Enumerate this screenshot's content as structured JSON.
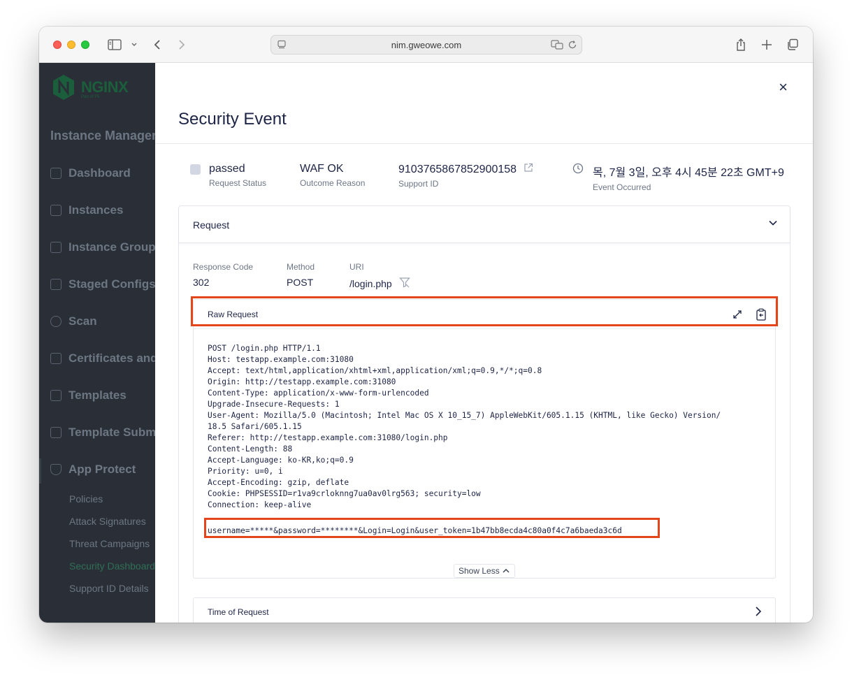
{
  "browser": {
    "url": "nim.gweowe.com"
  },
  "sidebar": {
    "logo_text": "NGINX",
    "logo_sub": "Part of F5",
    "section_title": "Instance Manager",
    "items": [
      {
        "label": "Dashboard",
        "icon": "bar-chart-icon"
      },
      {
        "label": "Instances",
        "icon": "server-icon"
      },
      {
        "label": "Instance Groups",
        "icon": "group-icon"
      },
      {
        "label": "Staged Configs",
        "icon": "staged-icon"
      },
      {
        "label": "Scan",
        "icon": "scan-icon"
      },
      {
        "label": "Certificates and Keys",
        "icon": "certificate-icon"
      },
      {
        "label": "Templates",
        "icon": "template-icon"
      },
      {
        "label": "Template Submissions",
        "icon": "archive-icon"
      }
    ],
    "app_protect": {
      "label": "App Protect",
      "icon": "shield-icon",
      "subitems": [
        {
          "label": "Policies"
        },
        {
          "label": "Attack Signatures"
        },
        {
          "label": "Threat Campaigns"
        },
        {
          "label": "Security Dashboard"
        },
        {
          "label": "Support ID Details"
        }
      ]
    }
  },
  "panel": {
    "title": "Security Event",
    "close_label": "×",
    "summary": {
      "status_value": "passed",
      "status_label": "Request Status",
      "reason_value": "WAF OK",
      "reason_label": "Outcome Reason",
      "support_value": "9103765867852900158",
      "support_label": "Support ID",
      "event_value": "목, 7월 3일, 오후 4시 45분 22초 GMT+9",
      "event_label": "Event Occurred"
    },
    "request": {
      "header": "Request",
      "response_code_label": "Response Code",
      "response_code": "302",
      "method_label": "Method",
      "method": "POST",
      "uri_label": "URI",
      "uri": "/login.php",
      "raw_request_label": "Raw Request",
      "raw_lines": [
        "POST /login.php HTTP/1.1",
        "Host: testapp.example.com:31080",
        "Accept: text/html,application/xhtml+xml,application/xml;q=0.9,*/*;q=0.8",
        "Origin: http://testapp.example.com:31080",
        "Content-Type: application/x-www-form-urlencoded",
        "Upgrade-Insecure-Requests: 1",
        "User-Agent: Mozilla/5.0 (Macintosh; Intel Mac OS X 10_15_7) AppleWebKit/605.1.15 (KHTML, like Gecko) Version/",
        "18.5 Safari/605.1.15",
        "Referer: http://testapp.example.com:31080/login.php",
        "Content-Length: 88",
        "Accept-Language: ko-KR,ko;q=0.9",
        "Priority: u=0, i",
        "Accept-Encoding: gzip, deflate",
        "Cookie: PHPSESSID=r1va9crloknng7ua0av0lrg563; security=low",
        "Connection: keep-alive"
      ],
      "body_line": "username=*****&password=********&Login=Login&user_token=1b47bb8ecda4c80a0f4c7a6baeda3c6d",
      "show_less_label": "Show Less"
    },
    "time_of_request_label": "Time of Request"
  },
  "colors": {
    "highlight": "#e4451b",
    "sidebar_bg": "#2a2f37",
    "title_text": "#1d2446"
  }
}
